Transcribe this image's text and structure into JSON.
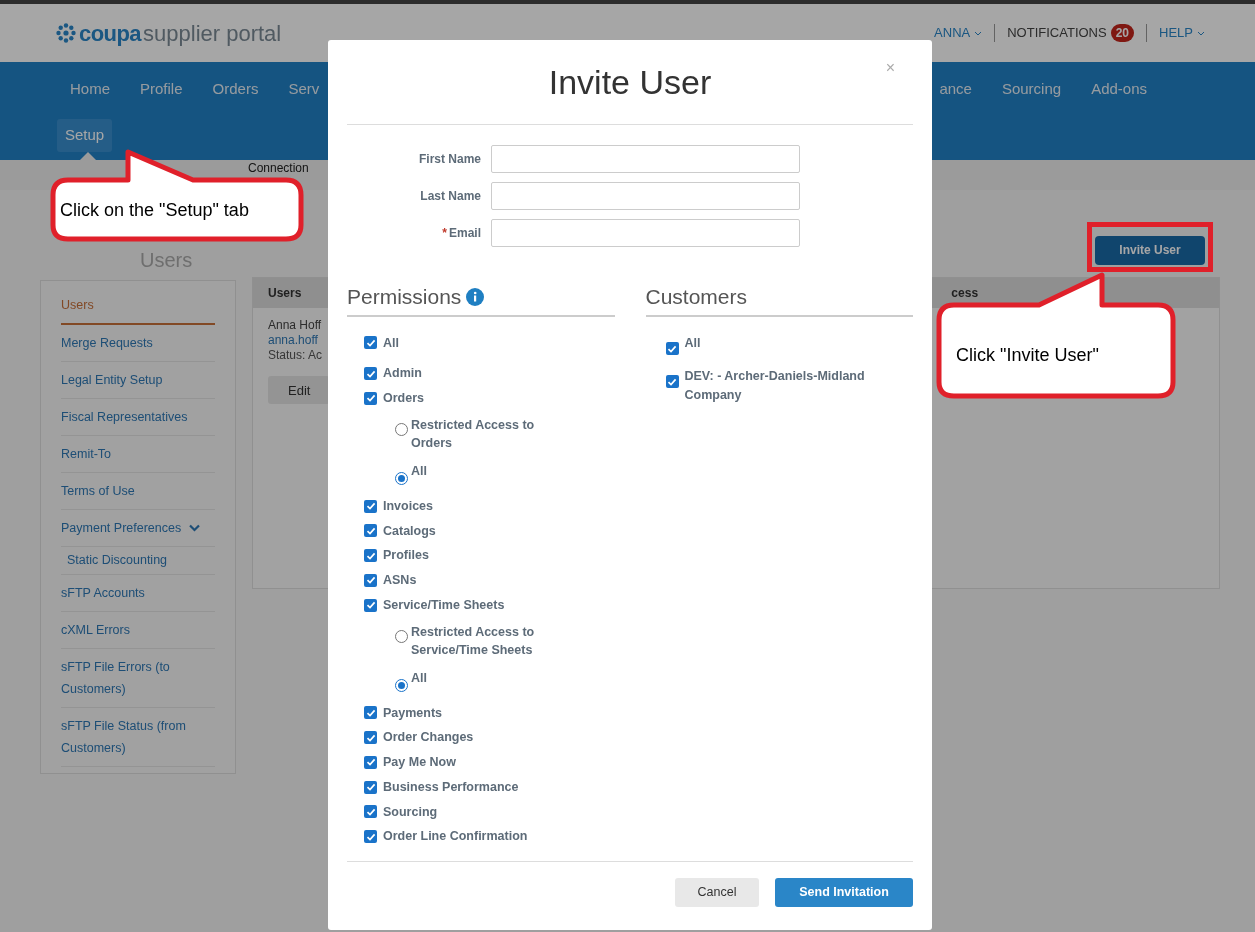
{
  "header": {
    "logo": {
      "brand": "coupa",
      "product": "supplier portal"
    },
    "user_menu": "ANNA",
    "notifications": {
      "label": "NOTIFICATIONS",
      "count": "20"
    },
    "help": "HELP"
  },
  "nav": {
    "left": [
      {
        "label": "Home",
        "selected": false
      },
      {
        "label": "Profile",
        "selected": false
      },
      {
        "label": "Orders",
        "selected": false
      },
      {
        "label": "Serv",
        "selected": false
      }
    ],
    "right": [
      {
        "label": "ance",
        "selected": false
      },
      {
        "label": "Sourcing",
        "selected": false
      },
      {
        "label": "Add-ons",
        "selected": false
      }
    ],
    "second_row": [
      {
        "label": "Setup",
        "selected": true
      }
    ]
  },
  "subnav": [
    "Connection"
  ],
  "page_title": "Users",
  "invite_button": "Invite User",
  "sidebar": {
    "items": [
      {
        "label": "Users",
        "selected": true
      },
      {
        "label": "Merge Requests",
        "selected": false
      },
      {
        "label": "Legal Entity Setup",
        "selected": false
      },
      {
        "label": "Fiscal Representatives",
        "selected": false
      },
      {
        "label": "Remit-To",
        "selected": false
      },
      {
        "label": "Terms of Use",
        "selected": false
      },
      {
        "label": "Payment Preferences",
        "selected": false,
        "expanded": true,
        "children": [
          {
            "label": "Static Discounting",
            "selected": false
          }
        ]
      },
      {
        "label": "sFTP Accounts",
        "selected": false
      },
      {
        "label": "cXML Errors",
        "selected": false
      },
      {
        "label": "sFTP File Errors (to Customers)",
        "selected": false
      },
      {
        "label": "sFTP File Status (from Customers)",
        "selected": false
      }
    ]
  },
  "table": {
    "columns": [
      "Users",
      "cess"
    ],
    "rows": [
      {
        "name": "Anna Hoff",
        "email": "anna.hoff",
        "status": "Status: Ac",
        "action": "Edit"
      }
    ]
  },
  "dialog": {
    "title": "Invite User",
    "close": "×",
    "fields": [
      {
        "label": "First Name"
      },
      {
        "label": "Last Name"
      },
      {
        "label": "Email",
        "required_mark": "*"
      }
    ],
    "permissions": {
      "title": "Permissions",
      "items": [
        {
          "label": "All",
          "checked": true
        },
        {
          "label": "Admin",
          "checked": true
        },
        {
          "label": "Orders",
          "checked": true,
          "options": [
            {
              "label": "Restricted Access to Orders",
              "selected": false
            },
            {
              "label": "All",
              "selected": true
            }
          ]
        },
        {
          "label": "Invoices",
          "checked": true
        },
        {
          "label": "Catalogs",
          "checked": true
        },
        {
          "label": "Profiles",
          "checked": true
        },
        {
          "label": "ASNs",
          "checked": true
        },
        {
          "label": "Service/Time Sheets",
          "checked": true,
          "options": [
            {
              "label": "Restricted Access to Service/Time Sheets",
              "selected": false
            },
            {
              "label": "All",
              "selected": true
            }
          ]
        },
        {
          "label": "Payments",
          "checked": true
        },
        {
          "label": "Order Changes",
          "checked": true
        },
        {
          "label": "Pay Me Now",
          "checked": true
        },
        {
          "label": "Business Performance",
          "checked": true
        },
        {
          "label": "Sourcing",
          "checked": true
        },
        {
          "label": "Order Line Confirmation",
          "checked": true
        }
      ]
    },
    "customers": {
      "title": "Customers",
      "items": [
        {
          "label": "All",
          "checked": true
        },
        {
          "label": "DEV: - Archer-Daniels-Midland Company",
          "checked": true
        }
      ]
    },
    "buttons": [
      {
        "label": "Cancel",
        "kind": "secondary"
      },
      {
        "label": "Send Invitation",
        "kind": "primary"
      }
    ]
  },
  "callouts": [
    {
      "text": "Click on the \"Setup\" tab"
    },
    {
      "text": "Click \"Invite User\""
    }
  ]
}
